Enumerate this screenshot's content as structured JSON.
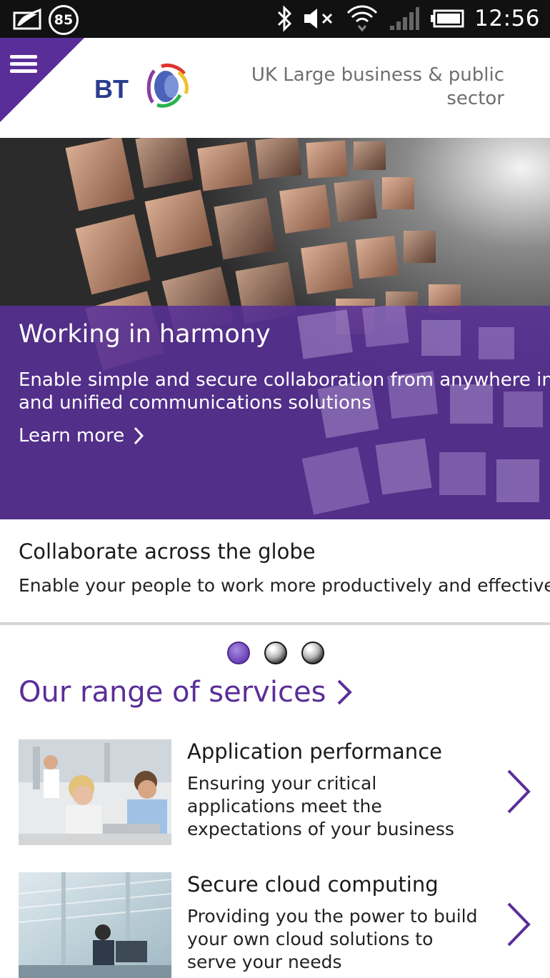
{
  "status_bar": {
    "notification_count": "85",
    "time": "12:56"
  },
  "header": {
    "logo_text": "BT",
    "sector_label": "UK Large business & public sector"
  },
  "hero": {
    "title": "Working in harmony",
    "description": "Enable simple and secure collaboration from anywhere in the w\nand unified communications solutions",
    "link_label": "Learn more"
  },
  "caption": {
    "title": "Collaborate across the globe",
    "subtitle": "Enable your people to work more productively and effectively"
  },
  "carousel": {
    "total": 3,
    "active_index": 0
  },
  "services": {
    "heading": "Our range of services",
    "items": [
      {
        "title": "Application performance",
        "description": "Ensuring your critical applications meet the expectations of your business"
      },
      {
        "title": "Secure cloud computing",
        "description": "Providing you the power to build your own cloud solutions to serve your needs"
      }
    ]
  },
  "colors": {
    "brand_purple": "#5a2e98",
    "status_bar": "#111111",
    "hero_panel": "#583096"
  }
}
